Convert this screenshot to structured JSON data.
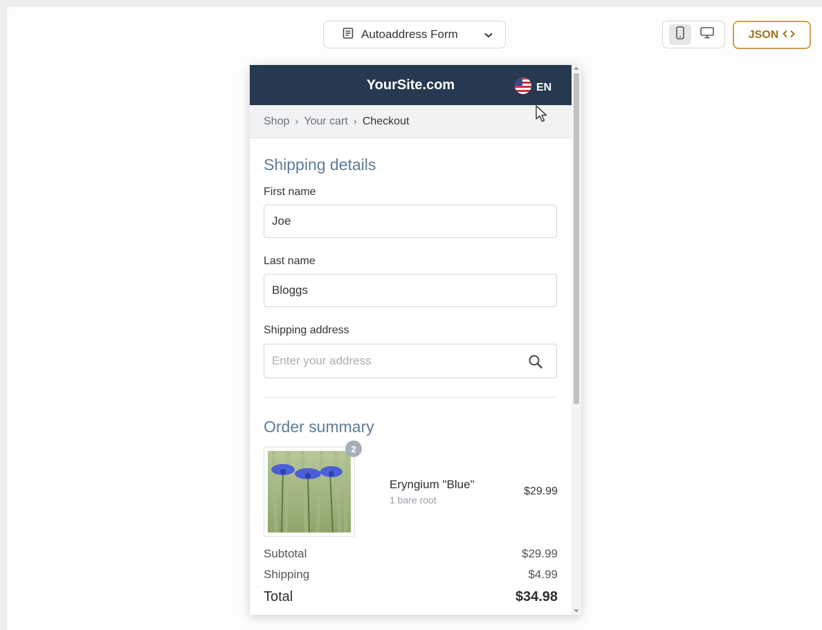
{
  "toolbar": {
    "form_selector": {
      "icon": "form-document-icon",
      "label": "Autoaddress Form",
      "dropdown_icon": "chevron-down-icon"
    },
    "device_toggle": [
      {
        "icon": "mobile-icon",
        "active": true
      },
      {
        "icon": "desktop-icon",
        "active": false
      }
    ],
    "json_button": {
      "label": "JSON",
      "icon": "code-icon"
    },
    "accent_color": "#c9a24a"
  },
  "site": {
    "title": "YourSite.com",
    "language": {
      "code": "EN",
      "flag_icon": "us-flag-icon"
    },
    "header_color": "#263950"
  },
  "breadcrumb": {
    "items": [
      "Shop",
      "Your cart",
      "Checkout"
    ]
  },
  "shipping": {
    "title": "Shipping details",
    "first_name": {
      "label": "First name",
      "value": "Joe"
    },
    "last_name": {
      "label": "Last name",
      "value": "Bloggs"
    },
    "address": {
      "label": "Shipping address",
      "value": "",
      "placeholder": "Enter your address"
    }
  },
  "order": {
    "title": "Order summary",
    "items": [
      {
        "name": "Eryngium \"Blue\"",
        "variant": "1 bare root",
        "price": "$29.99",
        "quantity": "2"
      }
    ],
    "subtotal": {
      "label": "Subtotal",
      "value": "$29.99"
    },
    "shipping": {
      "label": "Shipping",
      "value": "$4.99"
    },
    "total": {
      "label": "Total",
      "value": "$34.98"
    }
  }
}
